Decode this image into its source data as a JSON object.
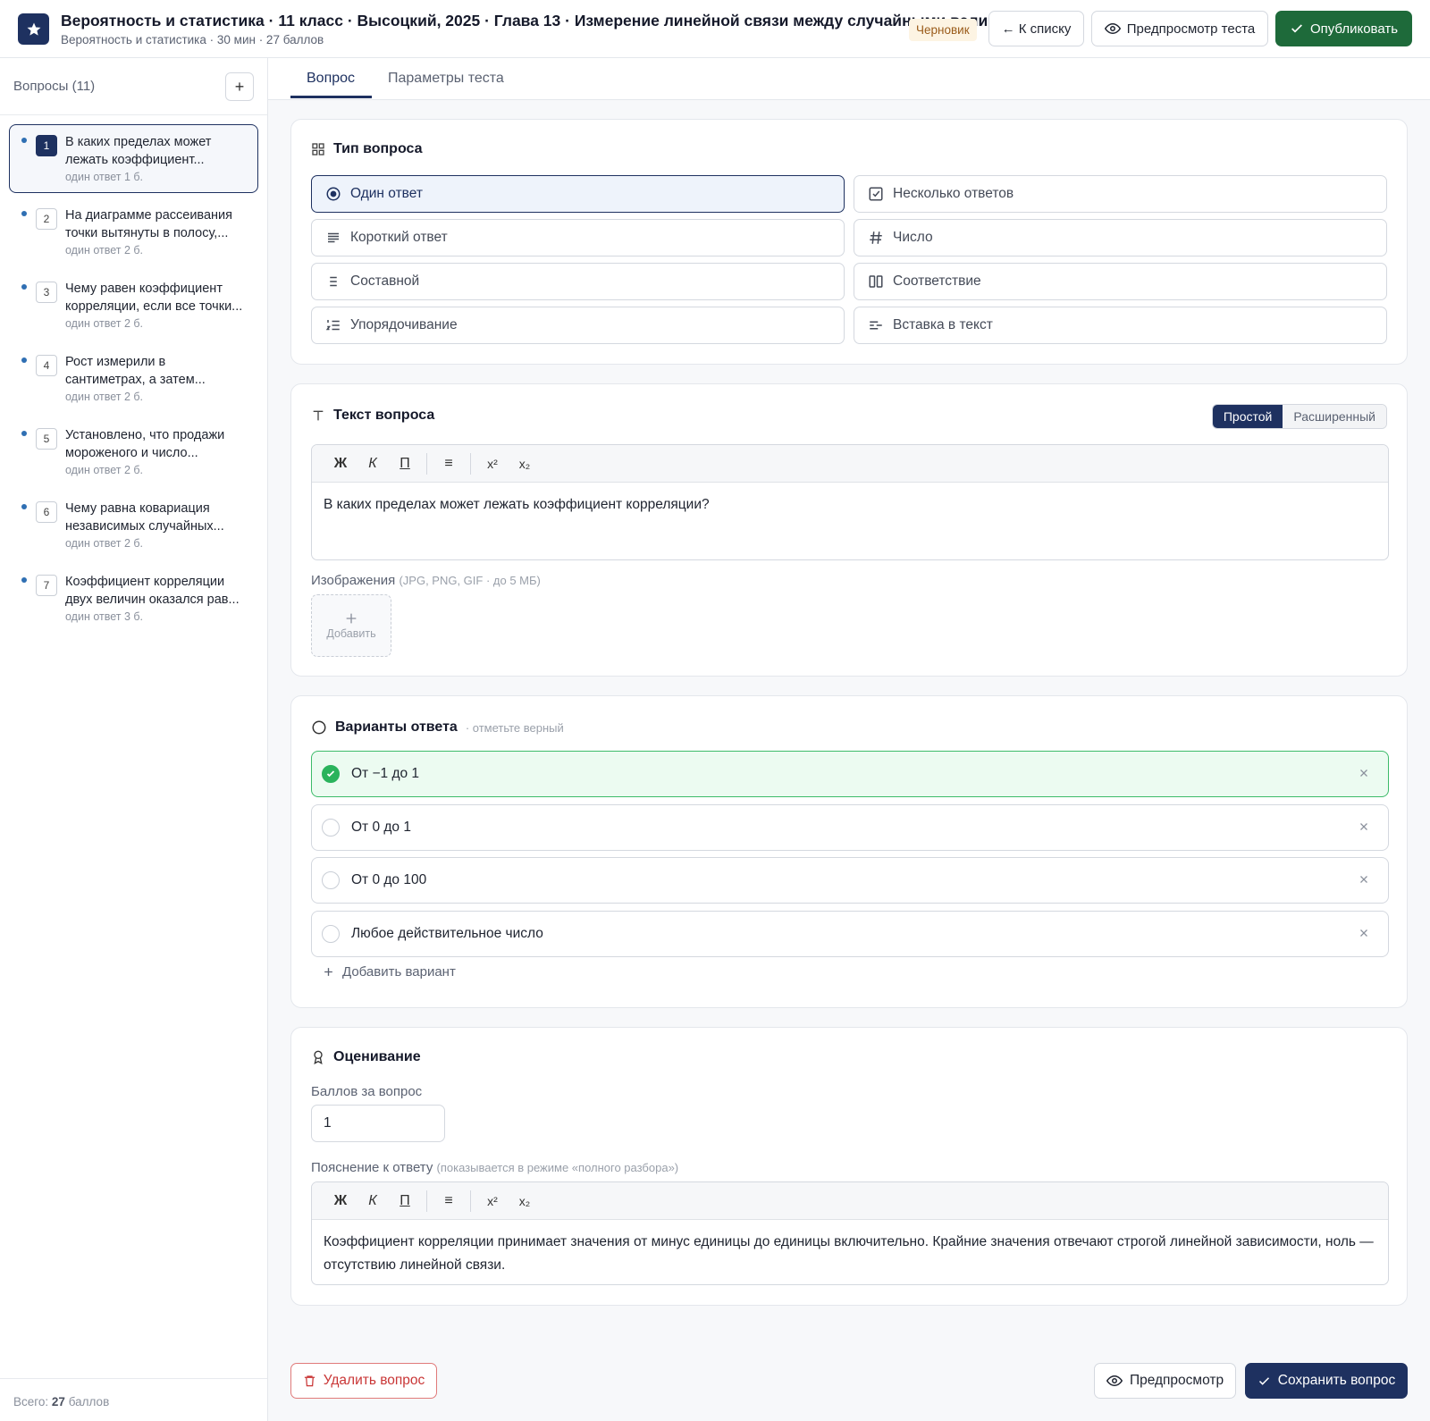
{
  "header": {
    "title": "Вероятность и статистика · 11 класс · Высоцкий, 2025 · Глава 13 · Измерение линейной связи между случайными величинами",
    "subtitle": "Вероятность и статистика · 30 мин · 27 баллов",
    "status": "Черновик",
    "back_label": "← К списку",
    "preview_label": "Предпросмотр теста",
    "publish_label": "Опубликовать"
  },
  "sidebar": {
    "title": "Вопросы (11)",
    "add_label": "+",
    "questions": [
      {
        "num": "1",
        "line1": "В каких пределах может",
        "line2": "лежать коэффициент...",
        "meta": "один ответ  1 б."
      },
      {
        "num": "2",
        "line1": "На диаграмме рассеивания",
        "line2": "точки вытянуты в полосу,...",
        "meta": "один ответ  2 б."
      },
      {
        "num": "3",
        "line1": "Чему равен коэффициент",
        "line2": "корреляции, если все точки...",
        "meta": "один ответ  2 б."
      },
      {
        "num": "4",
        "line1": "Рост измерили в",
        "line2": "сантиметрах, а затем...",
        "meta": "один ответ  2 б."
      },
      {
        "num": "5",
        "line1": "Установлено, что продажи",
        "line2": "мороженого и число...",
        "meta": "один ответ  2 б."
      },
      {
        "num": "6",
        "line1": "Чему равна ковариация",
        "line2": "независимых случайных...",
        "meta": "один ответ  2 б."
      },
      {
        "num": "7",
        "line1": "Коэффициент корреляции",
        "line2": "двух величин оказался рав...",
        "meta": "один ответ  3 б."
      }
    ],
    "footer_prefix": "Всего:",
    "footer_total": "27",
    "footer_suffix": "баллов"
  },
  "tabs": [
    {
      "label": "Вопрос"
    },
    {
      "label": "Параметры теста"
    }
  ],
  "question_type": {
    "title": "Тип вопроса",
    "types": [
      {
        "label": "Один ответ",
        "icon": "radio-target-icon"
      },
      {
        "label": "Несколько ответов",
        "icon": "checkbox-icon"
      },
      {
        "label": "Короткий ответ",
        "icon": "short-text-icon"
      },
      {
        "label": "Число",
        "icon": "hash-icon"
      },
      {
        "label": "Составной",
        "icon": "list-icon"
      },
      {
        "label": "Соответствие",
        "icon": "columns-icon"
      },
      {
        "label": "Упорядочивание",
        "icon": "ordered-list-icon"
      },
      {
        "label": "Вставка в текст",
        "icon": "insert-text-icon"
      }
    ]
  },
  "question_text": {
    "title": "Текст вопроса",
    "mode_simple": "Простой",
    "mode_advanced": "Расширенный",
    "toolbar": {
      "bold": "Ж",
      "italic": "К",
      "underline": "П",
      "list": "≡",
      "sup": "x²",
      "sub": "x₂"
    },
    "text": "В каких пределах может лежать коэффициент корреляции?",
    "images_label": "Изображения",
    "images_hint": "(JPG, PNG, GIF · до 5 МБ)",
    "add_image": "Добавить"
  },
  "answers": {
    "title": "Варианты ответа",
    "hint": "· отметьте верный",
    "options": [
      {
        "text": "От −1 до 1",
        "correct": true
      },
      {
        "text": "От 0 до 1",
        "correct": false
      },
      {
        "text": "От 0 до 100",
        "correct": false
      },
      {
        "text": "Любое действительное число",
        "correct": false
      }
    ],
    "add_label": "Добавить вариант"
  },
  "grading": {
    "title": "Оценивание",
    "points_label": "Баллов за вопрос",
    "points_value": "1",
    "explanation_label": "Пояснение к ответу",
    "explanation_hint": "(показывается в режиме «полного разбора»)",
    "explanation_text": "Коэффициент корреляции принимает значения от минус единицы до единицы включительно. Крайние значения отвечают строгой линейной зависимости, ноль — отсутствию линейной связи."
  },
  "footer": {
    "delete_label": "Удалить вопрос",
    "preview_label": "Предпросмотр",
    "save_label": "Сохранить вопрос"
  },
  "colors": {
    "navy": "#1e3160",
    "publish_green": "#1e6a3a",
    "correct_green": "#2ab35c",
    "danger_red": "#c93636"
  }
}
